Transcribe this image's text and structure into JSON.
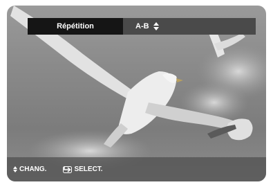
{
  "option": {
    "name": "Répétition",
    "value": "A-B"
  },
  "help": {
    "change_label": "CHANG.",
    "select_label": "SELECT."
  },
  "icons": {
    "updown": "up-down-arrows-icon",
    "enter": "enter-return-icon"
  },
  "colors": {
    "option_name_bg": "#151515",
    "option_value_bg": "#4a4a4a",
    "text": "#ffffff"
  }
}
